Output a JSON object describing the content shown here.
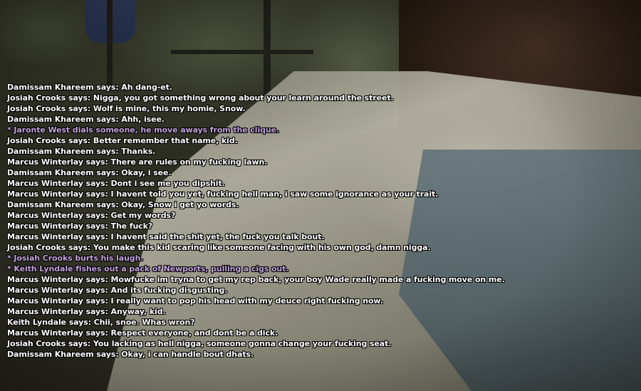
{
  "colors": {
    "say": "#ffffff",
    "action": "#c2a2da"
  },
  "chat": {
    "lines": [
      {
        "type": "say",
        "text": "Damissam Khareem says: Ah dang-et."
      },
      {
        "type": "say",
        "text": "Josiah Crooks says: Nigga, you got something wrong about your learn around the street."
      },
      {
        "type": "say",
        "text": "Josiah Crooks says: Wolf is mine, this my homie, Snow."
      },
      {
        "type": "say",
        "text": "Damissam Khareem says: Ahh, isee."
      },
      {
        "type": "action",
        "text": "* Jaronte West dials someone, he move aways from the clique."
      },
      {
        "type": "say",
        "text": "Josiah Crooks says: Better remember that name, kid."
      },
      {
        "type": "say",
        "text": "Damissam Khareem says: Thanks."
      },
      {
        "type": "say",
        "text": "Marcus Winterlay says: There are rules on my fucking lawn."
      },
      {
        "type": "say",
        "text": "Damissam Khareem says: Okay, i see."
      },
      {
        "type": "say",
        "text": "Marcus Winterlay says: Dont i see me you dipshit."
      },
      {
        "type": "say",
        "text": "Marcus Winterlay says: I havent told you yet, fucking hell man, i saw some ignorance as your trait."
      },
      {
        "type": "say",
        "text": "Damissam Khareem says: Okay, Snow i get yo words."
      },
      {
        "type": "say",
        "text": "Marcus Winterlay says: Get my words?"
      },
      {
        "type": "say",
        "text": "Marcus Winterlay says: The fuck?"
      },
      {
        "type": "say",
        "text": "Marcus Winterlay says: I havent said the shit yet, the fuck you talk bout."
      },
      {
        "type": "say",
        "text": "Josiah Crooks says: You make this kid scaring like someone facing with his own god, damn nigga."
      },
      {
        "type": "action",
        "text": "* Josiah Crooks burts his laugh."
      },
      {
        "type": "action",
        "text": "* Keith Lyndale fishes out a pack of Newports, pulling a cigs out."
      },
      {
        "type": "say",
        "text": "Marcus Winterlay says: Mowfucke im tryna to get my rep back, your boy Wade really made a fucking move on me."
      },
      {
        "type": "say",
        "text": "Marcus Winterlay says: And its fucking disgusting."
      },
      {
        "type": "say",
        "text": "Marcus Winterlay says: I really want to pop his head with my deuce right fucking now."
      },
      {
        "type": "say",
        "text": "Marcus Winterlay says: Anyway, kid."
      },
      {
        "type": "say",
        "text": "Keith Lyndale says: Chii, snoe. Whas wron?"
      },
      {
        "type": "say",
        "text": "Marcus Winterlay says: Respect everyone, and dont be a dick."
      },
      {
        "type": "say",
        "text": "Josiah Crooks says: You lacking as hell nigga, someone gonna change your fucking seat."
      },
      {
        "type": "say",
        "text": "Damissam Khareem says: Okay, i can handle bout dhats."
      }
    ]
  }
}
